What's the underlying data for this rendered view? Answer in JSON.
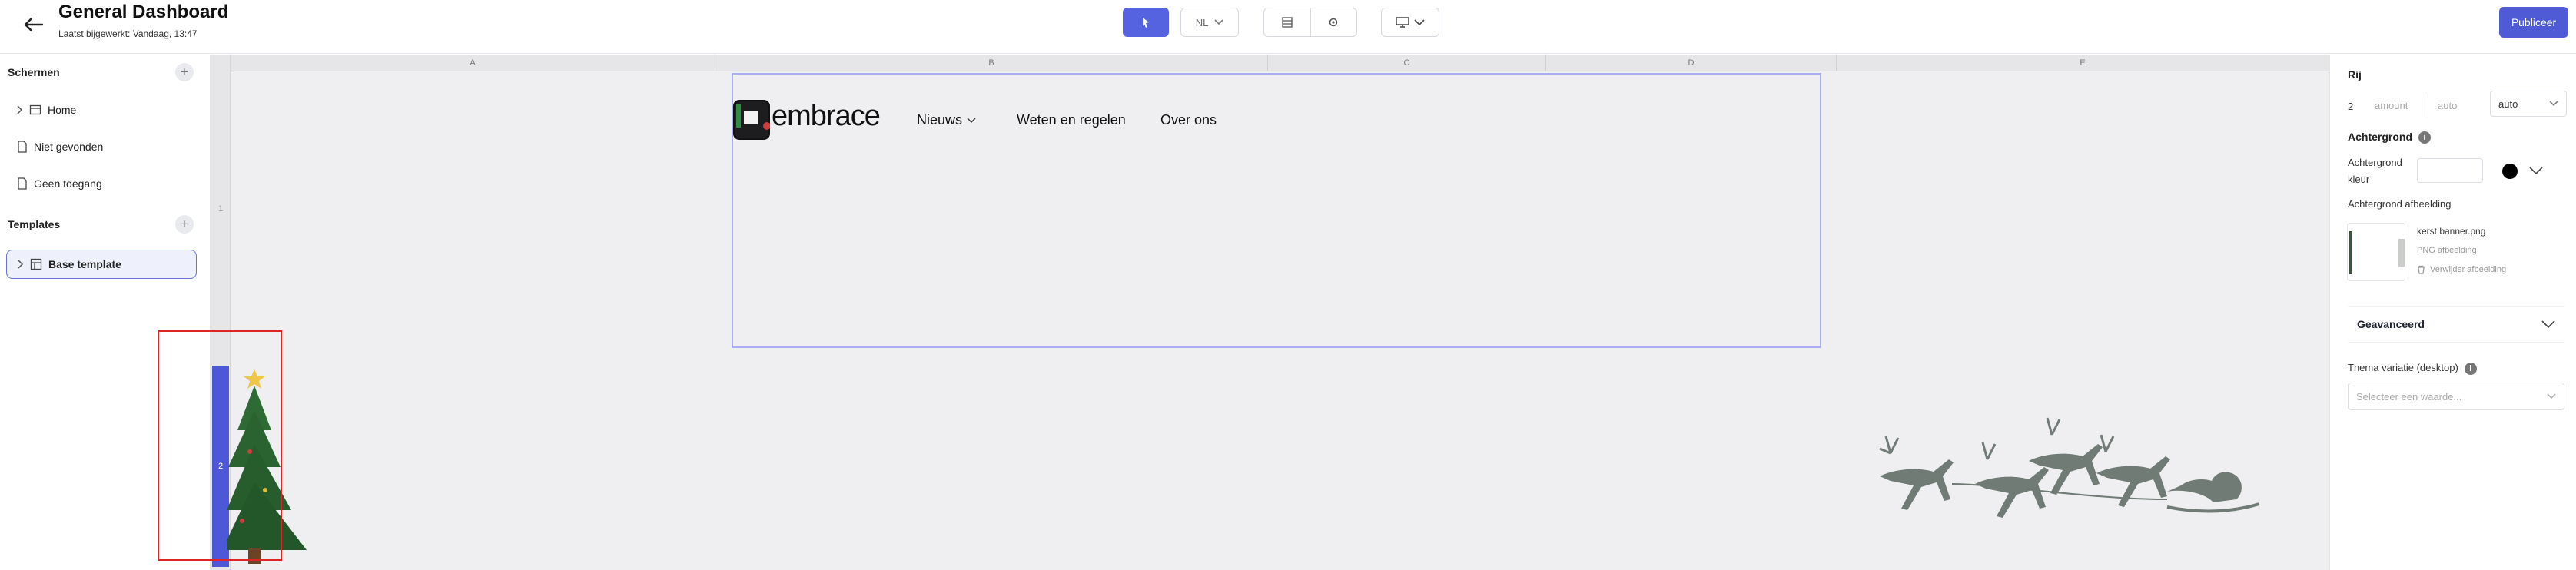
{
  "header": {
    "title": "General Dashboard",
    "subtitle": "Laatst bijgewerkt: Vandaag, 13:47",
    "language": "NL",
    "publish_label": "Publiceer"
  },
  "sidebar": {
    "screens_heading": "Schermen",
    "screens": [
      {
        "label": "Home"
      },
      {
        "label": "Niet gevonden"
      },
      {
        "label": "Geen toegang"
      }
    ],
    "templates_heading": "Templates",
    "templates": [
      {
        "label": "Base template"
      }
    ]
  },
  "canvas": {
    "columns": [
      "A",
      "B",
      "C",
      "D",
      "E"
    ],
    "rows": [
      "1",
      "2"
    ],
    "logo_text": "embrace",
    "nav": [
      "Nieuws",
      "Weten en regelen",
      "Over ons"
    ]
  },
  "right_panel": {
    "row_heading": "Rij",
    "row_value": "2",
    "amount_placeholder": "amount",
    "auto_placeholder": "auto",
    "auto_select": "auto",
    "background_heading": "Achtergrond",
    "background_color_label": "Achtergrond kleur",
    "background_image_label": "Achtergrond afbeelding",
    "image_name": "kerst banner.png",
    "image_type": "PNG afbeelding",
    "remove_image": "Verwijder afbeelding",
    "advanced": "Geavanceerd",
    "theme_variation_label": "Thema variatie (desktop)",
    "theme_placeholder": "Selecteer een waarde..."
  },
  "colors": {
    "accent": "#4f5bd5",
    "selection_box": "#e02424"
  }
}
